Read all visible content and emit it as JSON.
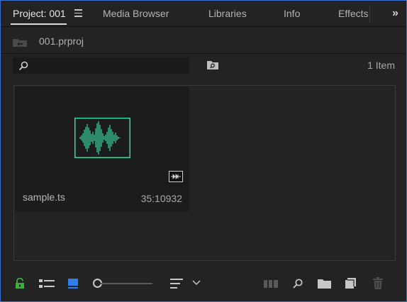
{
  "tabs": [
    {
      "label": "Project: 001",
      "active": true
    },
    {
      "label": "Media Browser",
      "active": false
    },
    {
      "label": "Libraries",
      "active": false
    },
    {
      "label": "Info",
      "active": false
    },
    {
      "label": "Effects",
      "active": false
    }
  ],
  "project": {
    "file_name": "001.prproj"
  },
  "search": {
    "value": "",
    "placeholder": ""
  },
  "item_count": "1 Item",
  "items": [
    {
      "name": "sample.ts",
      "duration": "35:10932",
      "media_type": "audio-waveform"
    }
  ],
  "colors": {
    "accent_border": "#3c6fd0",
    "waveform": "#3ad3a3",
    "lock_green": "#3fae3f",
    "icon_view_blue": "#2d7ff0"
  },
  "icons": {
    "tab_menu": "hamburger-menu-icon",
    "overflow": "double-chevron-right-icon",
    "project_folder": "project-folder-icon",
    "search": "magnifier-icon",
    "bin_search": "find-in-bin-icon",
    "av_badge": "audio-video-link-icon",
    "lock": "lock-icon",
    "list_view": "list-view-icon",
    "icon_view": "icon-view-icon",
    "sort": "sort-icon",
    "automate": "automate-to-sequence-icon",
    "find": "find-icon",
    "new_bin": "new-bin-icon",
    "new_item": "new-item-icon",
    "trash": "trash-icon"
  }
}
